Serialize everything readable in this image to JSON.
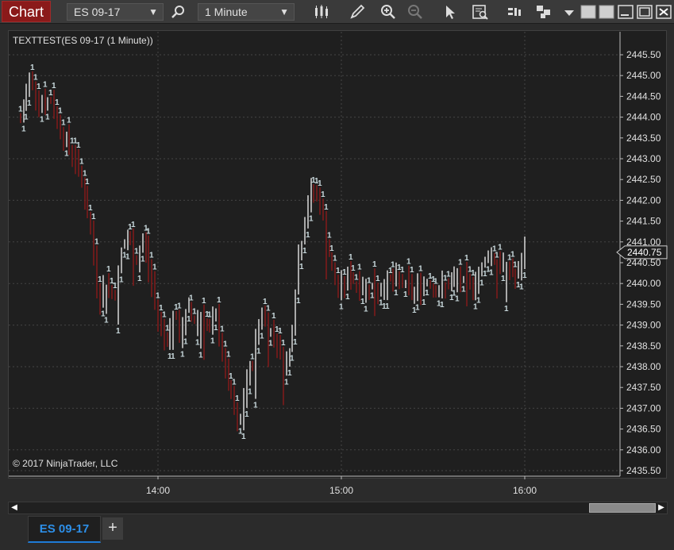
{
  "toolbar": {
    "brand": "Chart",
    "instrument": "ES 09-17",
    "interval": "1 Minute"
  },
  "chart": {
    "indicator_label": "TEXTTEST(ES 09-17 (1 Minute))",
    "copyright": "© 2017 NinjaTrader, LLC",
    "current_price_label": "2440.75",
    "colors": {
      "background": "#1f1f1f",
      "up": "#e6e6e6",
      "down": "#8b1a1a",
      "grid": "#444444",
      "label": "#c8d8dc"
    }
  },
  "chart_data": {
    "type": "bar",
    "style": "ohlc-minute-bars",
    "y_ticks": [
      "2435.50",
      "2436.00",
      "2436.50",
      "2437.00",
      "2437.50",
      "2438.00",
      "2438.50",
      "2439.00",
      "2439.50",
      "2440.00",
      "2440.50",
      "2441.00",
      "2441.50",
      "2442.00",
      "2442.50",
      "2443.00",
      "2443.50",
      "2444.00",
      "2444.50",
      "2445.00",
      "2445.50"
    ],
    "x_ticks": [
      "14:00",
      "15:00",
      "16:00"
    ],
    "ylim": [
      2435.5,
      2445.5
    ],
    "last_price": 2440.75,
    "bar_label": "1",
    "grid": true,
    "price_path": [
      [
        13.25,
        2443.9
      ],
      [
        13.3,
        2445.0
      ],
      [
        13.34,
        2444.5
      ],
      [
        13.38,
        2444.3
      ],
      [
        13.42,
        2444.4
      ],
      [
        13.46,
        2443.8
      ],
      [
        13.5,
        2443.4
      ],
      [
        13.55,
        2443.0
      ],
      [
        13.6,
        2442.1
      ],
      [
        13.64,
        2441.0
      ],
      [
        13.68,
        2439.6
      ],
      [
        13.72,
        2440.1
      ],
      [
        13.76,
        2439.6
      ],
      [
        13.8,
        2440.8
      ],
      [
        13.84,
        2441.1
      ],
      [
        13.88,
        2440.5
      ],
      [
        13.92,
        2441.1
      ],
      [
        13.96,
        2440.1
      ],
      [
        14.0,
        2439.2
      ],
      [
        14.04,
        2438.6
      ],
      [
        14.08,
        2439.3
      ],
      [
        14.12,
        2438.7
      ],
      [
        14.16,
        2439.4
      ],
      [
        14.2,
        2439.1
      ],
      [
        14.24,
        2439.3
      ],
      [
        14.28,
        2438.8
      ],
      [
        14.32,
        2439.2
      ],
      [
        14.36,
        2438.0
      ],
      [
        14.4,
        2437.2
      ],
      [
        14.44,
        2436.4
      ],
      [
        14.48,
        2437.6
      ],
      [
        14.52,
        2438.2
      ],
      [
        14.56,
        2439.4
      ],
      [
        14.6,
        2438.9
      ],
      [
        14.64,
        2438.8
      ],
      [
        14.68,
        2438.0
      ],
      [
        14.72,
        2438.4
      ],
      [
        14.76,
        2440.4
      ],
      [
        14.8,
        2441.6
      ],
      [
        14.84,
        2442.3
      ],
      [
        14.88,
        2442.0
      ],
      [
        14.92,
        2441.0
      ],
      [
        14.96,
        2440.0
      ],
      [
        15.0,
        2439.9
      ],
      [
        15.04,
        2440.2
      ],
      [
        15.08,
        2440.0
      ],
      [
        15.12,
        2439.9
      ],
      [
        15.16,
        2440.0
      ],
      [
        15.2,
        2439.8
      ],
      [
        15.24,
        2440.1
      ],
      [
        15.28,
        2440.0
      ],
      [
        15.32,
        2440.1
      ],
      [
        15.36,
        2439.9
      ],
      [
        15.4,
        2439.8
      ],
      [
        15.44,
        2440.0
      ],
      [
        15.48,
        2440.1
      ],
      [
        15.52,
        2439.8
      ],
      [
        15.56,
        2439.9
      ],
      [
        15.6,
        2440.0
      ],
      [
        15.64,
        2440.1
      ],
      [
        15.68,
        2440.0
      ],
      [
        15.72,
        2440.0
      ],
      [
        15.76,
        2440.3
      ],
      [
        15.8,
        2440.8
      ],
      [
        15.84,
        2440.5
      ],
      [
        15.88,
        2440.4
      ],
      [
        15.92,
        2440.3
      ],
      [
        15.96,
        2440.1
      ],
      [
        16.0,
        2440.75
      ]
    ]
  },
  "tabs": {
    "active": "ES 09-17",
    "add_label": "+"
  }
}
